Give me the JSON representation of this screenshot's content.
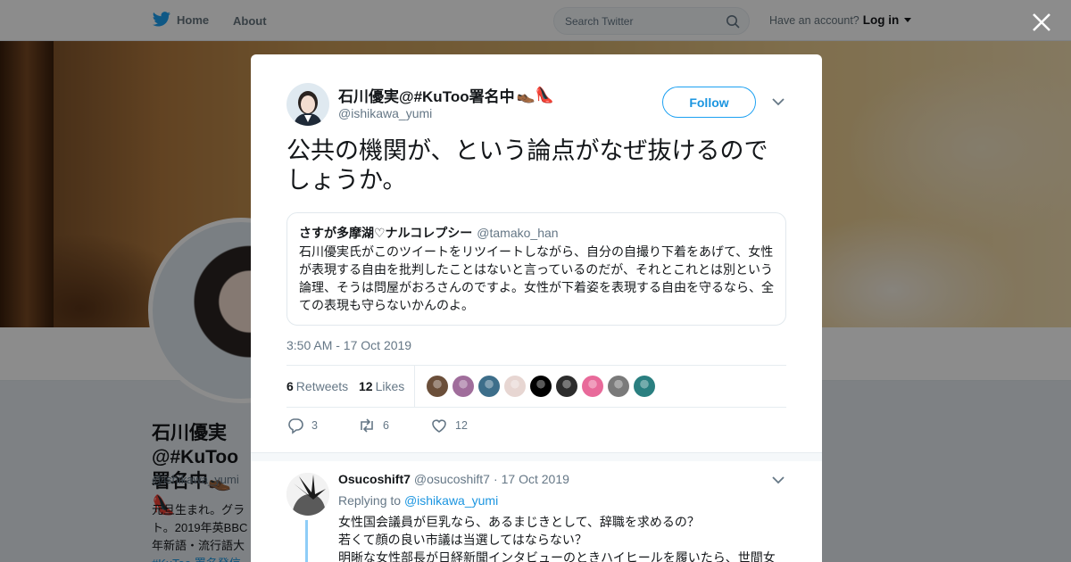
{
  "topbar": {
    "home_label": "Home",
    "about_label": "About",
    "search_placeholder": "Search Twitter",
    "account_prompt": "Have an account?",
    "login_label": "Log in"
  },
  "profile": {
    "name": "石川優実@#KuToo署名中👞👠",
    "handle": "@ishikawa_yumi",
    "bio_lines": [
      "元旦生まれ。グラ",
      "ト。2019年英BBC",
      "年新語・流行語大",
      "#KuToo 署名発信"
    ]
  },
  "tweet": {
    "author_name": "石川優実@#KuToo署名中",
    "author_emoji": "👞👠",
    "author_handle": "@ishikawa_yumi",
    "follow_label": "Follow",
    "text": "公共の機関が、という論点がなぜ抜けるのでしょうか。",
    "quote": {
      "name": "さすが多摩湖♡ナルコレプシー",
      "handle": "@tamako_han",
      "text": "石川優実氏がこのツイートをリツイートしながら、自分の自撮り下着をあげて、女性が表現する自由を批判したことはないと言っているのだが、それとこれとは別という論理、そうは問屋がおろさんのですよ。女性が下着姿を表現する自由を守るなら、全ての表現も守らないかんのよ。"
    },
    "timestamp": "3:50 AM - 17 Oct 2019",
    "retweets_count": "6",
    "retweets_label": "Retweets",
    "likes_count": "12",
    "likes_label": "Likes",
    "likers_colors": [
      "#6b4f3a",
      "#a06d9b",
      "#3d6e8a",
      "#e7d6d2",
      "#000000",
      "#2c2c2c",
      "#e86a9a",
      "#7a7a7a",
      "#2a7f80"
    ],
    "actions": {
      "reply_count": "3",
      "retweet_count": "6",
      "like_count": "12"
    }
  },
  "reply": {
    "name": "Osucoshift7",
    "handle": "@osucoshift7",
    "sep": "·",
    "date": "17 Oct 2019",
    "replying_prefix": "Replying to",
    "replying_to": "@ishikawa_yumi",
    "lines": [
      "女性国会議員が巨乳なら、あるまじきとして、辞職を求めるの？",
      "若くて顔の良い市議は当選してはならない？",
      "明晰な女性部長が日経新聞インタビューのときハイヒールを履いたら、世間女"
    ]
  }
}
